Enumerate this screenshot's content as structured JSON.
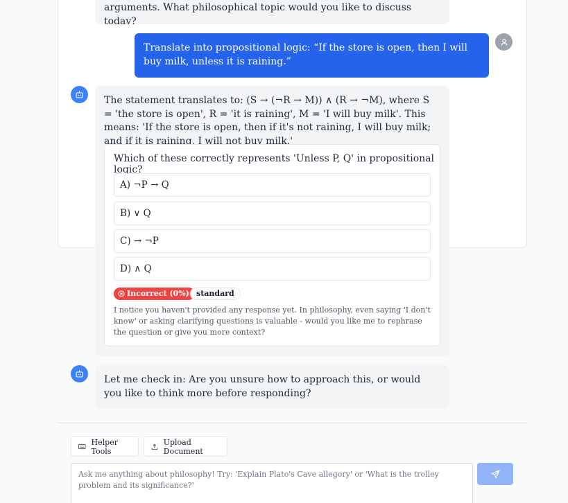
{
  "messages": {
    "top_partial": "arguments. What philosophical topic would you like to discuss today?",
    "user_prompt": "Translate into propositional logic: “If the store is open, then I will buy milk, unless it is raining.”",
    "ai_answer": "The statement translates to: (S → (¬R → M)) ∧ (R → ¬M), where S = 'the store is open', R = 'it is raining', M = 'I will buy milk'. This means: 'If the store is open, then if it's not raining, I will buy milk; and if it is raining, I will not buy milk.'",
    "checkin": "Let me check in: Are you unsure how to approach this, or would you like to think more before responding?"
  },
  "quiz": {
    "question": "Which of these correctly represents 'Unless P, Q' in propositional logic?",
    "options": [
      "A) ¬P → Q",
      "B) ∨ Q",
      "C) → ¬P",
      "D) ∧ Q"
    ],
    "result_label": "Incorrect (0%)",
    "level": "standard",
    "feedback": "I notice you haven't provided any response yet. In philosophy, even saying 'I don't know' or asking clarifying questions is valuable - would you like me to rephrase the question or give you more context?"
  },
  "toolbar": {
    "helper_tools_label": "Helper Tools",
    "upload_label": "Upload Document"
  },
  "input": {
    "placeholder": "Ask me anything about philosophy! Try: 'Explain Plato's Cave allegory' or 'What is the trolley problem and its significance?'"
  },
  "colors": {
    "accent": "#2563eb",
    "bot_avatar": "#3b82f6",
    "user_avatar": "#9ca3af",
    "incorrect": "#ef4444",
    "send_disabled": "#93b4f6"
  }
}
